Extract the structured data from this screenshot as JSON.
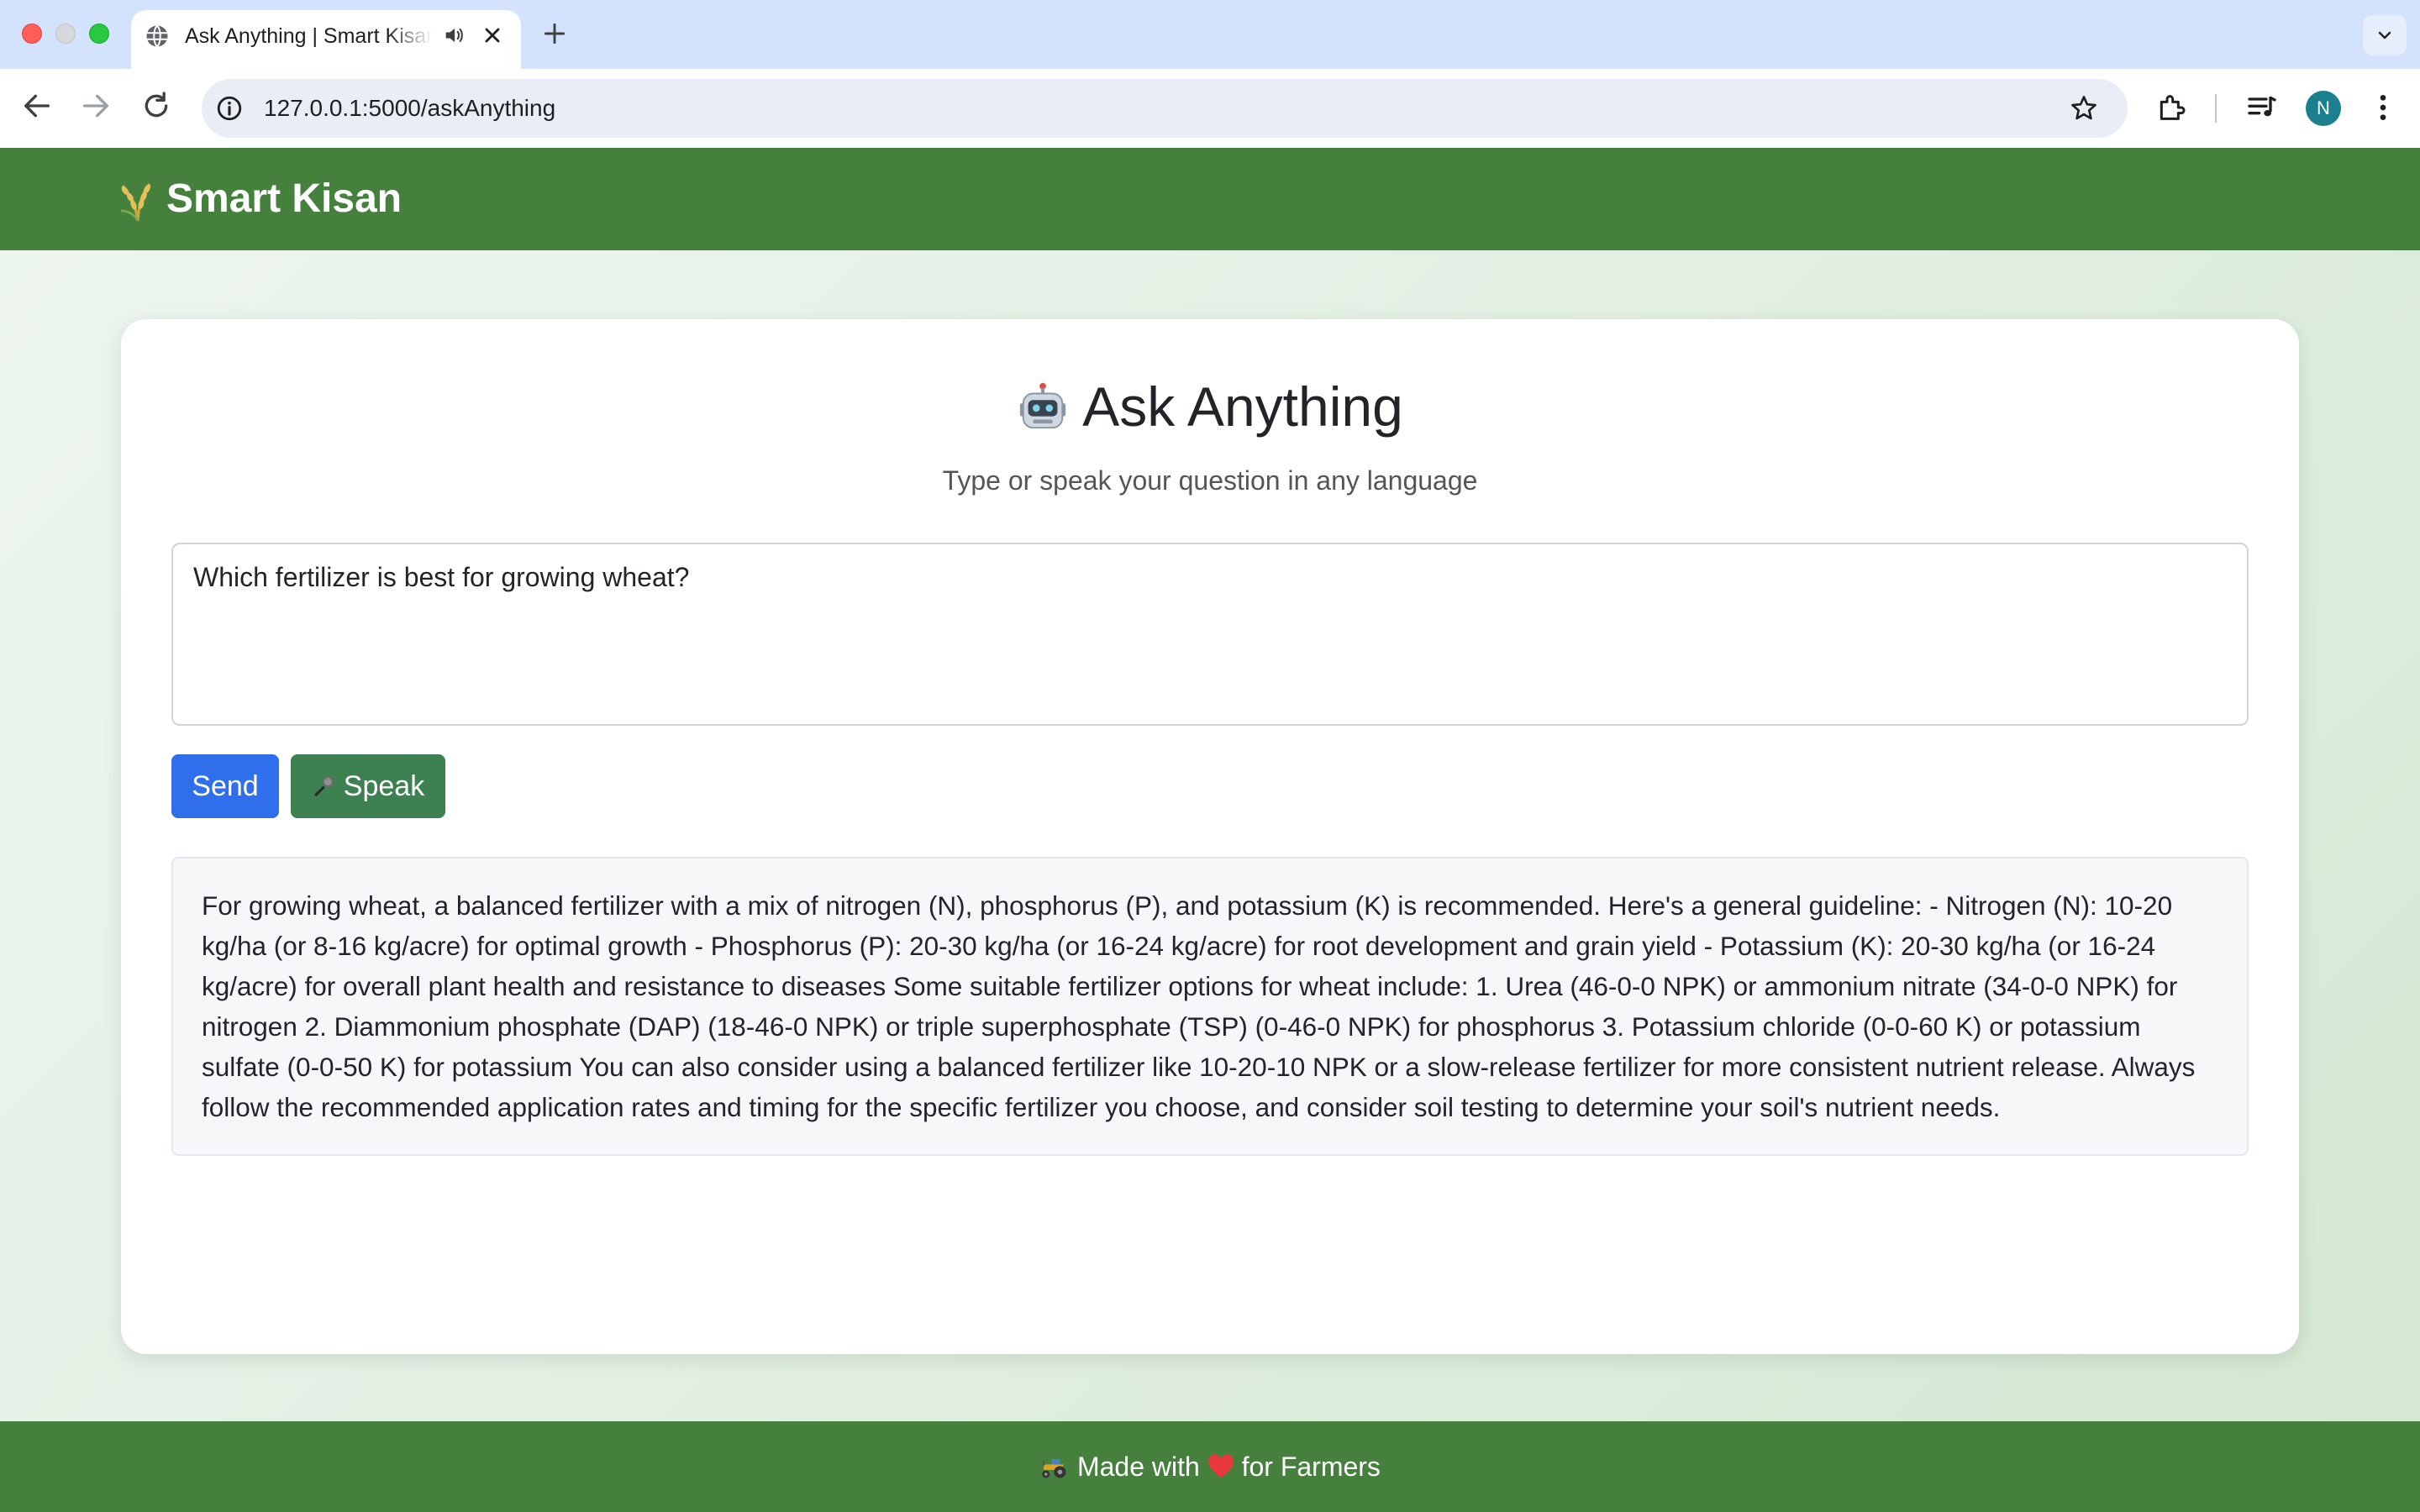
{
  "browser": {
    "tab_title": "Ask Anything | Smart Kisan",
    "url": "127.0.0.1:5000/askAnything",
    "profile_initial": "N"
  },
  "header": {
    "brand_icon": "rice-sheaf-icon",
    "brand": "Smart Kisan"
  },
  "main": {
    "title_icon": "robot-icon",
    "title": "Ask Anything",
    "subtitle": "Type or speak your question in any language",
    "question_value": "Which fertilizer is best for growing wheat?",
    "send_label": "Send",
    "speak_icon": "microphone-icon",
    "speak_label": "Speak",
    "answer": "For growing wheat, a balanced fertilizer with a mix of nitrogen (N), phosphorus (P), and potassium (K) is recommended. Here's a general guideline: - Nitrogen (N): 10-20 kg/ha (or 8-16 kg/acre) for optimal growth - Phosphorus (P): 20-30 kg/ha (or 16-24 kg/acre) for root development and grain yield - Potassium (K): 20-30 kg/ha (or 16-24 kg/acre) for overall plant health and resistance to diseases Some suitable fertilizer options for wheat include: 1. Urea (46-0-0 NPK) or ammonium nitrate (34-0-0 NPK) for nitrogen 2. Diammonium phosphate (DAP) (18-46-0 NPK) or triple superphosphate (TSP) (0-46-0 NPK) for phosphorus 3. Potassium chloride (0-0-60 K) or potassium sulfate (0-0-50 K) for potassium You can also consider using a balanced fertilizer like 10-20-10 NPK or a slow-release fertilizer for more consistent nutrient release. Always follow the recommended application rates and timing for the specific fertilizer you choose, and consider soil testing to determine your soil's nutrient needs."
  },
  "footer": {
    "prefix": "Made with",
    "suffix": "for Farmers",
    "icons": [
      "tractor-icon",
      "red-heart-icon"
    ]
  },
  "colors": {
    "header_green": "#46803d",
    "send_blue": "#2f6fec",
    "speak_green": "#3e8150"
  }
}
